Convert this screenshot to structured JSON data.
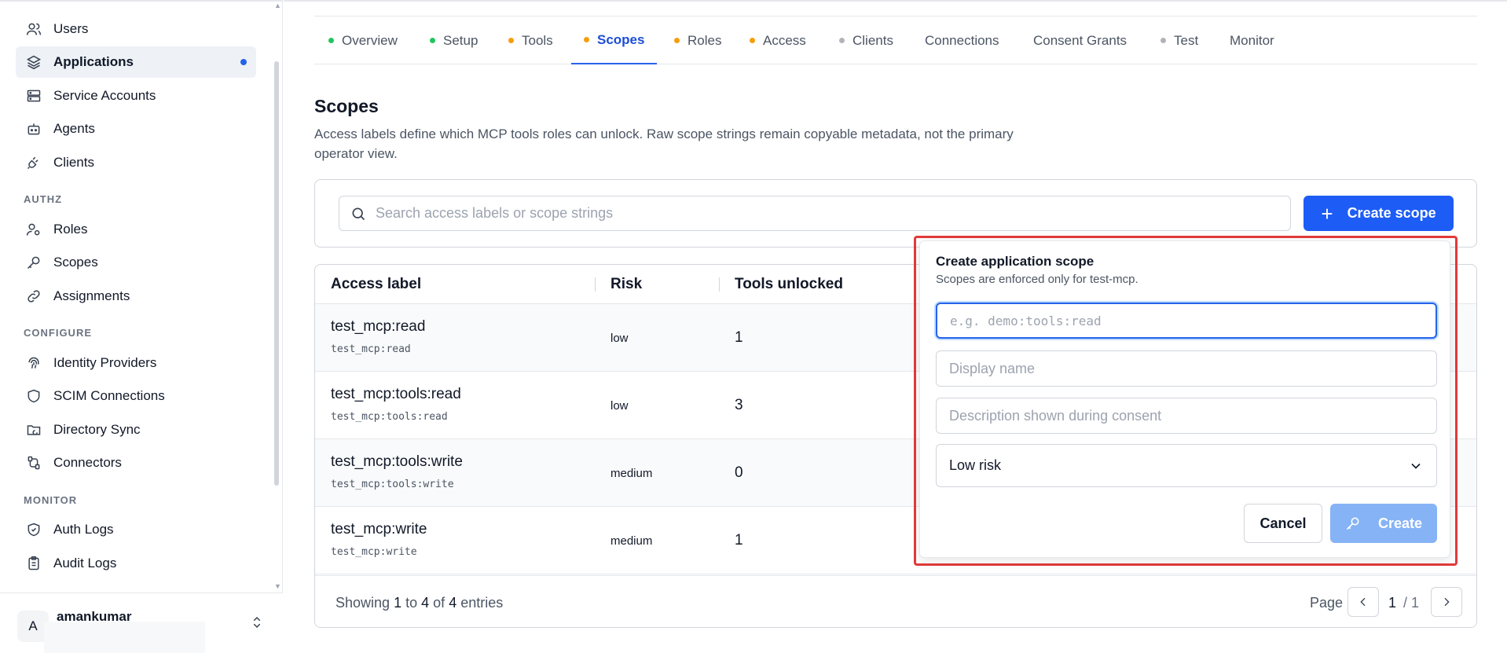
{
  "sidebar": {
    "items_top": [
      {
        "label": "Users",
        "icon": "users-icon"
      },
      {
        "label": "Applications",
        "icon": "layers-icon",
        "active": true
      },
      {
        "label": "Service Accounts",
        "icon": "server-icon"
      },
      {
        "label": "Agents",
        "icon": "bot-icon"
      },
      {
        "label": "Clients",
        "icon": "plug-icon"
      }
    ],
    "sections": {
      "authz": "AUTHZ",
      "configure": "CONFIGURE",
      "monitor": "MONITOR"
    },
    "authz_items": [
      {
        "label": "Roles",
        "icon": "user-cog-icon"
      },
      {
        "label": "Scopes",
        "icon": "key-icon"
      },
      {
        "label": "Assignments",
        "icon": "link-icon"
      }
    ],
    "configure_items": [
      {
        "label": "Identity Providers",
        "icon": "fingerprint-icon"
      },
      {
        "label": "SCIM Connections",
        "icon": "shield-icon"
      },
      {
        "label": "Directory Sync",
        "icon": "folder-sync-icon"
      },
      {
        "label": "Connectors",
        "icon": "cable-icon"
      }
    ],
    "monitor_items": [
      {
        "label": "Auth Logs",
        "icon": "shield-check-icon"
      },
      {
        "label": "Audit Logs",
        "icon": "clipboard-icon"
      }
    ],
    "user": {
      "initial": "A",
      "name": "amankumar"
    }
  },
  "tabs": [
    {
      "label": "Overview",
      "dot": "#22c55e"
    },
    {
      "label": "Setup",
      "dot": "#22c55e"
    },
    {
      "label": "Tools",
      "dot": "#f59e0b"
    },
    {
      "label": "Scopes",
      "dot": "#f59e0b",
      "active": true
    },
    {
      "label": "Roles",
      "dot": "#f59e0b"
    },
    {
      "label": "Access",
      "dot": "#f59e0b"
    },
    {
      "label": "Clients",
      "dot": "#b0b4ba"
    },
    {
      "label": "Connections",
      "dot": ""
    },
    {
      "label": "Consent Grants",
      "dot": ""
    },
    {
      "label": "Test",
      "dot": "#b0b4ba"
    },
    {
      "label": "Monitor",
      "dot": ""
    }
  ],
  "page": {
    "title": "Scopes",
    "description": "Access labels define which MCP tools roles can unlock. Raw scope strings remain copyable metadata, not the primary operator view."
  },
  "search": {
    "placeholder": "Search access labels or scope strings",
    "create_label": "Create scope"
  },
  "table": {
    "headers": {
      "label": "Access label",
      "risk": "Risk",
      "tools": "Tools unlocked"
    },
    "rows": [
      {
        "label": "test_mcp:read",
        "scope": "test_mcp:read",
        "risk": "low",
        "tools": "1"
      },
      {
        "label": "test_mcp:tools:read",
        "scope": "test_mcp:tools:read",
        "risk": "low",
        "tools": "3"
      },
      {
        "label": "test_mcp:tools:write",
        "scope": "test_mcp:tools:write",
        "risk": "medium",
        "tools": "0"
      },
      {
        "label": "test_mcp:write",
        "scope": "test_mcp:write",
        "risk": "medium",
        "tools": "1"
      }
    ],
    "footer": {
      "showing_prefix": "Showing",
      "from": "1",
      "to_word": "to",
      "to": "4",
      "of_word": "of",
      "total": "4",
      "suffix": "entries",
      "page_label": "Page",
      "current_page": "1",
      "total_pages": "/ 1"
    }
  },
  "popover": {
    "title": "Create application scope",
    "subtitle": "Scopes are enforced only for test-mcp.",
    "scope_placeholder": "e.g. demo:tools:read",
    "display_placeholder": "Display name",
    "description_placeholder": "Description shown during consent",
    "risk_value": "Low risk",
    "cancel_label": "Cancel",
    "create_label": "Create"
  }
}
